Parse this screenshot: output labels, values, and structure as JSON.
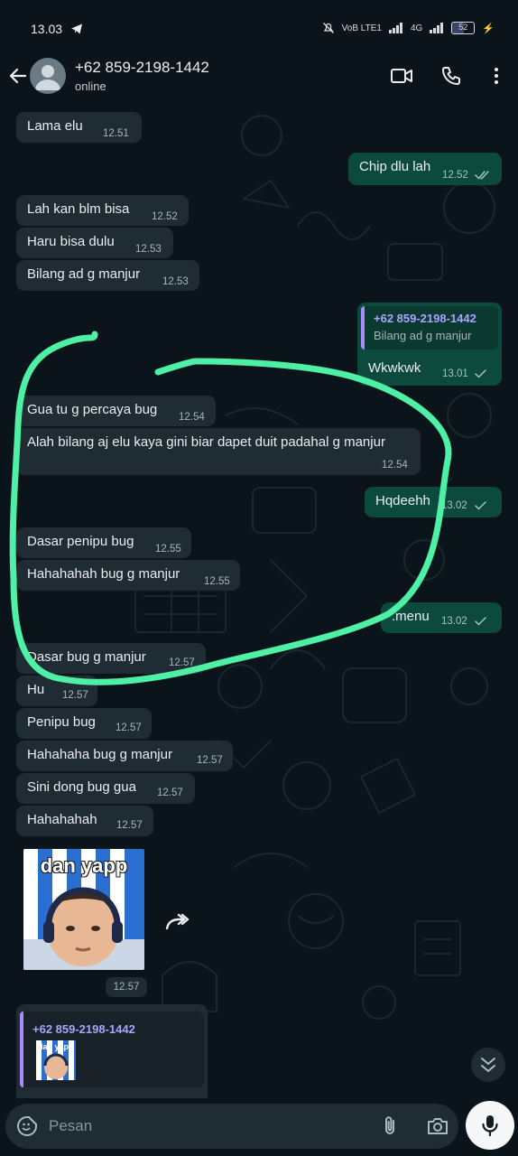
{
  "status_bar": {
    "time": "13.03",
    "network_labels": "VoB LTE1",
    "signal_extra": "4G",
    "battery": "52"
  },
  "header": {
    "contact_name": "+62 859-2198-1442",
    "contact_status": "online"
  },
  "messages": [
    {
      "dir": "in",
      "text": "Lama elu",
      "time": "12.51"
    },
    {
      "dir": "out",
      "text": "Chip dlu lah",
      "time": "12.52",
      "status": "delivered"
    },
    {
      "dir": "in",
      "text": "Lah kan blm bisa",
      "time": "12.52"
    },
    {
      "dir": "in",
      "text": "Haru bisa dulu",
      "time": "12.53"
    },
    {
      "dir": "in",
      "text": "Bilang ad g manjur",
      "time": "12.53"
    },
    {
      "dir": "out",
      "quote_name": "+62 859-2198-1442",
      "quote_text": "Bilang ad g manjur",
      "text": "Wkwkwk",
      "time": "13.01",
      "status": "sent"
    },
    {
      "dir": "in",
      "text": "Gua tu g percaya bug",
      "time": "12.54"
    },
    {
      "dir": "in",
      "text": "Alah bilang aj elu kaya gini biar dapet duit padahal g manjur",
      "time": "12.54"
    },
    {
      "dir": "out",
      "text": "Hqdeehh",
      "time": "13.02",
      "status": "sent"
    },
    {
      "dir": "in",
      "text": "Dasar penipu bug",
      "time": "12.55"
    },
    {
      "dir": "in",
      "text": "Hahahahah bug g manjur",
      "time": "12.55"
    },
    {
      "dir": "out",
      "text": ".menu",
      "time": "13.02",
      "status": "sent"
    },
    {
      "dir": "in",
      "text": "Dasar bug g manjur",
      "time": "12.57"
    },
    {
      "dir": "in",
      "text": "Hu",
      "time": "12.57"
    },
    {
      "dir": "in",
      "text": "Penipu bug",
      "time": "12.57"
    },
    {
      "dir": "in",
      "text": "Hahahaha bug g manjur",
      "time": "12.57"
    },
    {
      "dir": "in",
      "text": "Sini dong bug gua",
      "time": "12.57"
    },
    {
      "dir": "in",
      "text": "Hahahahah",
      "time": "12.57"
    }
  ],
  "sticker": {
    "caption": "dan yapp",
    "time": "12.57"
  },
  "last_message": {
    "quote_name": "+62 859-2198-1442",
    "sticker_caption": "dan yapp"
  },
  "input": {
    "placeholder": "Pesan"
  },
  "colors": {
    "background": "#0b141a",
    "incoming_bubble": "#1f2c34",
    "outgoing_bubble": "#0d4a3e",
    "highlight_stroke": "#4ef0a6",
    "read_tick": "#a6c2bb"
  },
  "icons": [
    "telegram-icon",
    "back-arrow-icon",
    "avatar",
    "video-call-icon",
    "phone-icon",
    "more-menu-icon",
    "forward-icon",
    "chevron-down-icon",
    "emoji-sticker-icon",
    "attach-icon",
    "camera-icon",
    "mic-icon"
  ]
}
